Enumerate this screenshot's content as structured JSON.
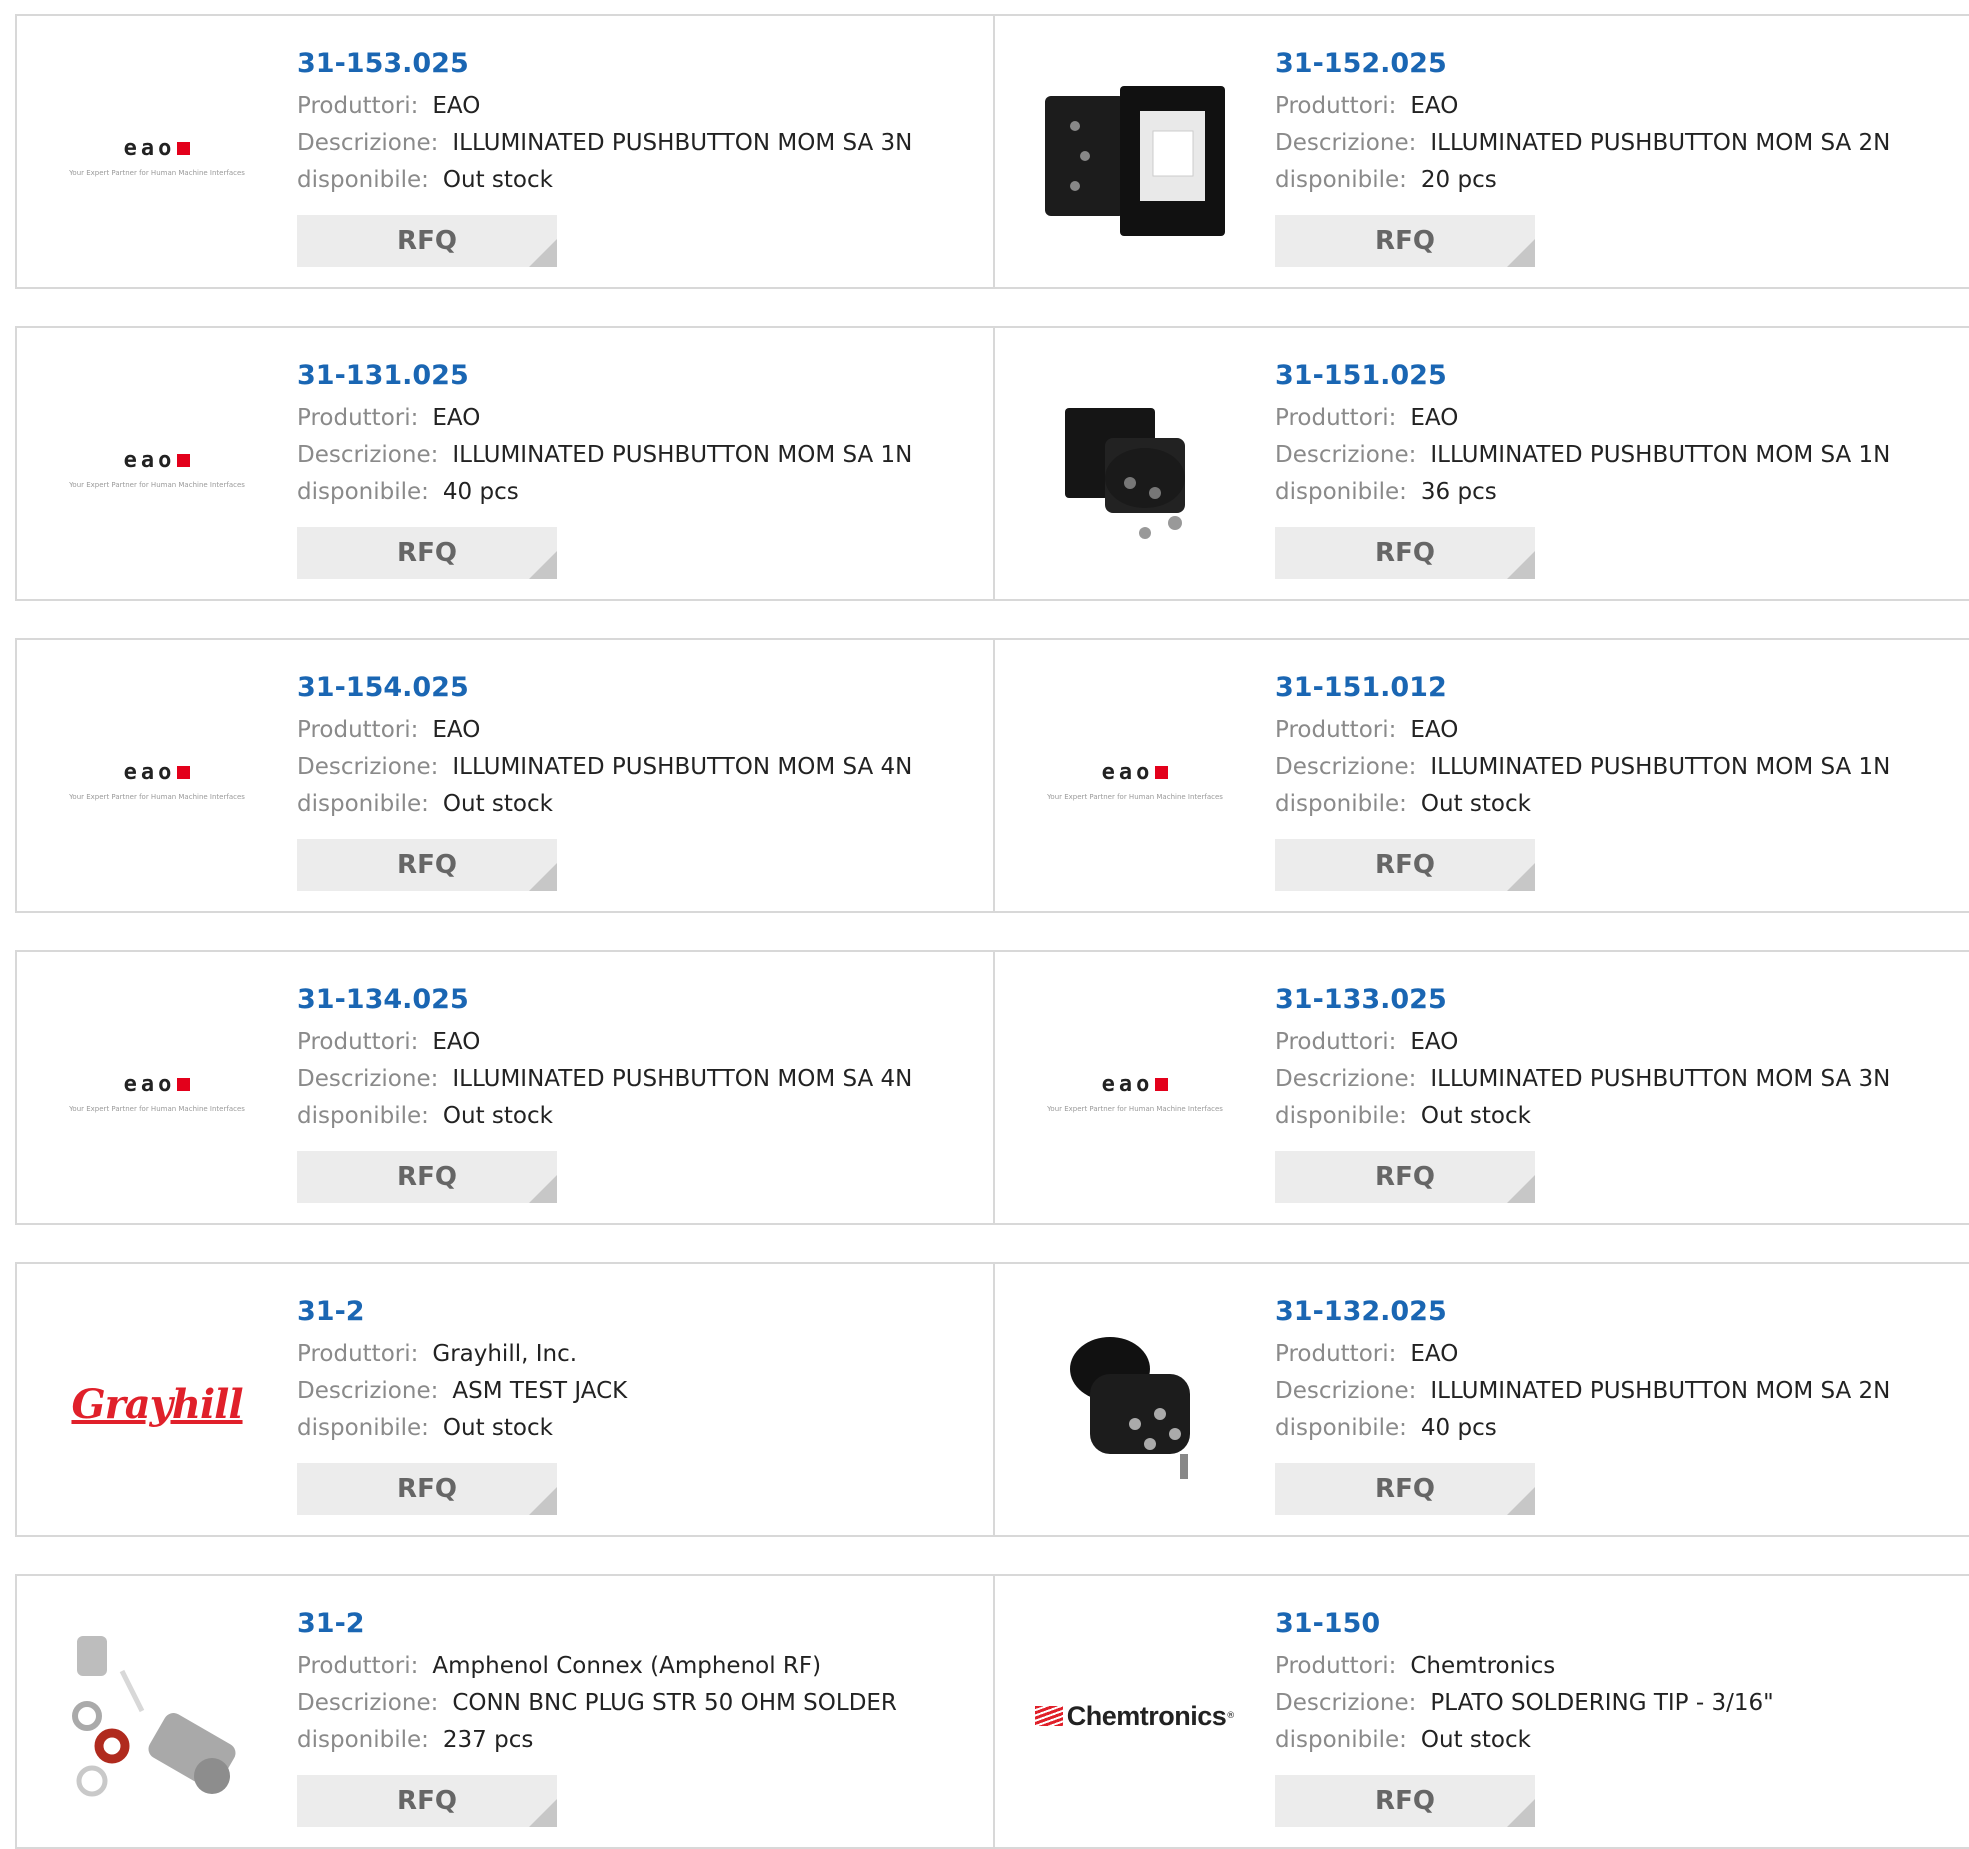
{
  "labels": {
    "manufacturer": "Produttori:",
    "description": "Descrizione:",
    "availability": "disponibile:",
    "rfq": "RFQ"
  },
  "logos": {
    "eao_word": "eao",
    "eao_tagline": "Your Expert Partner for Human Machine Interfaces",
    "grayhill_word": "Grayhill",
    "chemtronics_word": "Chemtronics",
    "chemtronics_mark": "®"
  },
  "colors": {
    "part_link": "#1a66b3",
    "label_gray": "#8a8a8a",
    "rfq_bg": "#ececec",
    "eao_red": "#e3001b"
  },
  "products": [
    {
      "part": "31-153.025",
      "manufacturer": "EAO",
      "description": "ILLUMINATED PUSHBUTTON MOM SA 3N",
      "availability": "Out stock",
      "image": "eao-logo"
    },
    {
      "part": "31-152.025",
      "manufacturer": "EAO",
      "description": "ILLUMINATED PUSHBUTTON MOM SA 2N",
      "availability": "20 pcs",
      "image": "pushbutton-square-photo"
    },
    {
      "part": "31-131.025",
      "manufacturer": "EAO",
      "description": "ILLUMINATED PUSHBUTTON MOM SA 1N",
      "availability": "40 pcs",
      "image": "eao-logo"
    },
    {
      "part": "31-151.025",
      "manufacturer": "EAO",
      "description": "ILLUMINATED PUSHBUTTON MOM SA 1N",
      "availability": "36 pcs",
      "image": "pushbutton-photo"
    },
    {
      "part": "31-154.025",
      "manufacturer": "EAO",
      "description": "ILLUMINATED PUSHBUTTON MOM SA 4N",
      "availability": "Out stock",
      "image": "eao-logo"
    },
    {
      "part": "31-151.012",
      "manufacturer": "EAO",
      "description": "ILLUMINATED PUSHBUTTON MOM SA 1N",
      "availability": "Out stock",
      "image": "eao-logo"
    },
    {
      "part": "31-134.025",
      "manufacturer": "EAO",
      "description": "ILLUMINATED PUSHBUTTON MOM SA 4N",
      "availability": "Out stock",
      "image": "eao-logo"
    },
    {
      "part": "31-133.025",
      "manufacturer": "EAO",
      "description": "ILLUMINATED PUSHBUTTON MOM SA 3N",
      "availability": "Out stock",
      "image": "eao-logo"
    },
    {
      "part": "31-2",
      "manufacturer": "Grayhill, Inc.",
      "description": "ASM TEST JACK",
      "availability": "Out stock",
      "image": "grayhill-logo"
    },
    {
      "part": "31-132.025",
      "manufacturer": "EAO",
      "description": "ILLUMINATED PUSHBUTTON MOM SA 2N",
      "availability": "40 pcs",
      "image": "pushbutton-round-photo"
    },
    {
      "part": "31-2",
      "manufacturer": "Amphenol Connex (Amphenol RF)",
      "description": "CONN BNC PLUG STR 50 OHM SOLDER",
      "availability": "237 pcs",
      "image": "bnc-connector-photo"
    },
    {
      "part": "31-150",
      "manufacturer": "Chemtronics",
      "description": "PLATO SOLDERING TIP - 3/16\"",
      "availability": "Out stock",
      "image": "chemtronics-logo"
    }
  ]
}
